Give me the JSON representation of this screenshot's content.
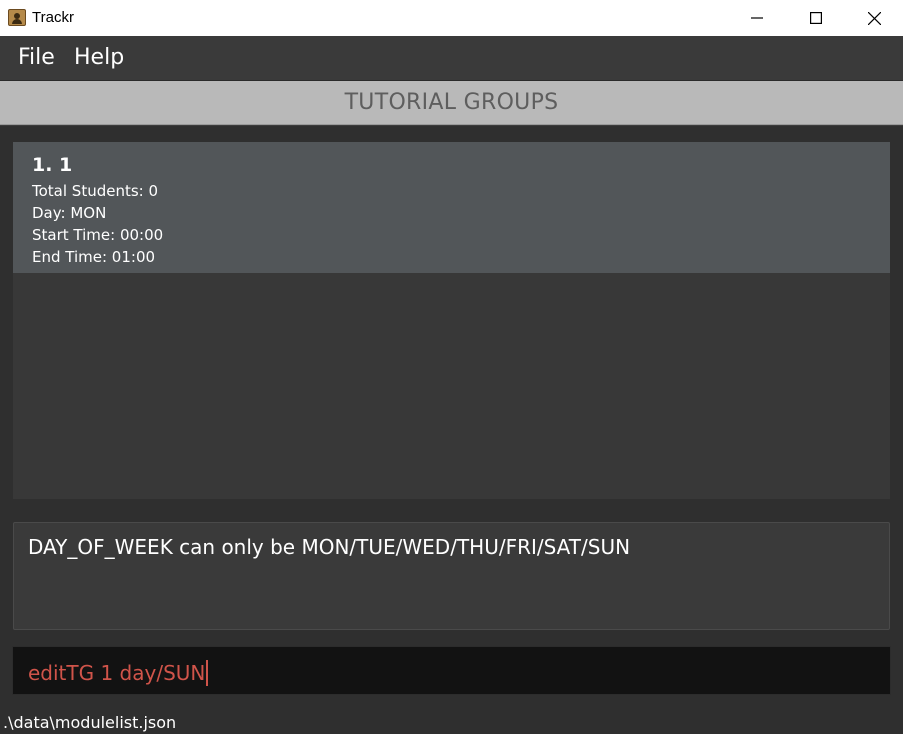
{
  "window": {
    "title": "Trackr",
    "controls": [
      "minimize-icon",
      "maximize-icon",
      "close-icon"
    ]
  },
  "menu": {
    "file": "File",
    "help": "Help"
  },
  "header": {
    "title": "TUTORIAL GROUPS"
  },
  "tutorial_groups": [
    {
      "title": "1.  1",
      "total_students": "Total Students: 0",
      "day": "Day: MON",
      "start_time": "Start Time: 00:00",
      "end_time": "End Time: 01:00"
    }
  ],
  "result": {
    "message": "DAY_OF_WEEK can only be MON/TUE/WED/THU/FRI/SAT/SUN"
  },
  "command": {
    "value": "editTG 1 day/SUN",
    "text_color": "#d0544a"
  },
  "status": {
    "file_path": ".\\data\\modulelist.json"
  }
}
